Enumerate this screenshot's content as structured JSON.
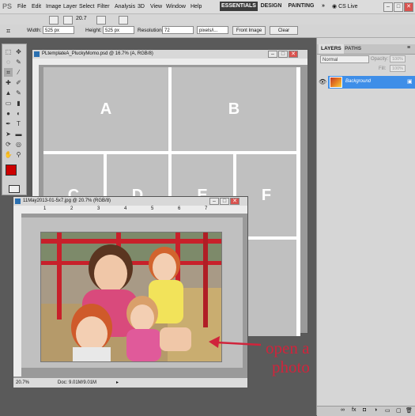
{
  "app": {
    "logo_text": "PS",
    "zoom": "20.7",
    "cs_live": "CS Live"
  },
  "menu": [
    "File",
    "Edit",
    "Image",
    "Layer",
    "Select",
    "Filter",
    "Analysis",
    "3D",
    "View",
    "Window",
    "Help"
  ],
  "workspaces": {
    "active": "ESSENTIALS",
    "design": "DESIGN",
    "painting": "PAINTING",
    "more": "»"
  },
  "window_controls": [
    "–",
    "□",
    "✕"
  ],
  "options": {
    "width_label": "Width:",
    "width_value": "525 px",
    "height_label": "Height:",
    "height_value": "525 px",
    "resolution_label": "Resolution:",
    "resolution_value": "72",
    "resolution_unit": "pixels/i...",
    "front_image": "Front Image",
    "clear": "Clear"
  },
  "layers_panel": {
    "tabs": [
      "LAYERS",
      "PATHS"
    ],
    "blend_mode": "Normal",
    "opacity_label": "Opacity:",
    "opacity_value": "100%",
    "fill_label": "Fill:",
    "fill_value": "100%",
    "layer_name": "Background"
  },
  "doc1": {
    "title": "PLtemplateA_PluckyMomo.psd @ 16.7% (A, RGB/8)",
    "cells": [
      "A",
      "B",
      "C",
      "D",
      "E",
      "F"
    ]
  },
  "doc2": {
    "title": "11May2013-01-5x7.jpg @ 20.7% (RGB/8)",
    "zoom": "20.7%",
    "doc_info": "Doc: 9.01M/9.01M",
    "ruler_ticks": [
      "1",
      "2",
      "3",
      "4",
      "5",
      "6",
      "7"
    ]
  },
  "annotation": {
    "line1": "open a",
    "line2": "photo",
    "color": "#d0243b"
  }
}
